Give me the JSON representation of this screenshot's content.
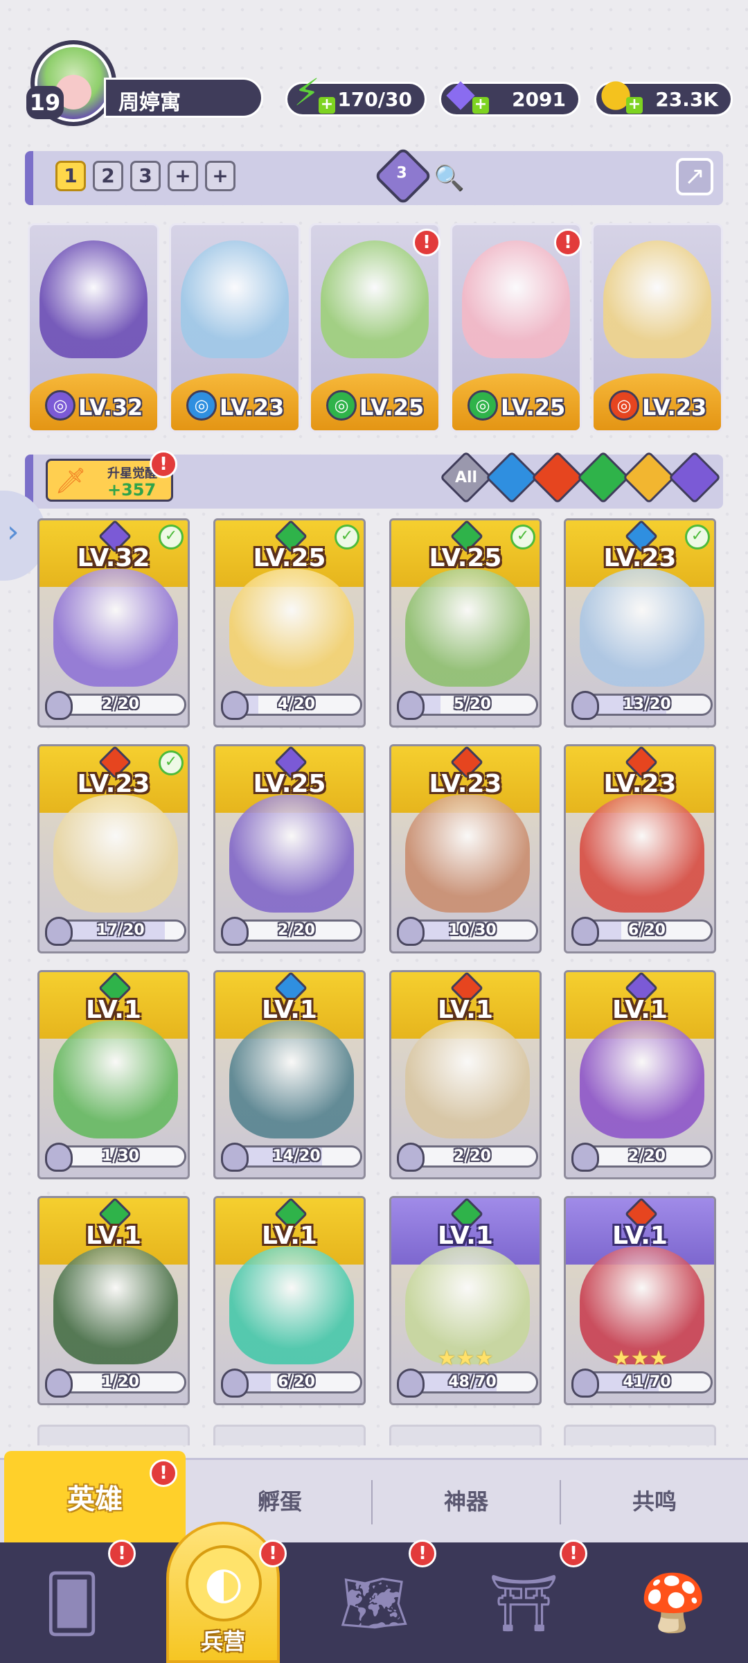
{
  "player": {
    "level": "19",
    "name": "周婷寓"
  },
  "resources": [
    {
      "icon": "energy-bolt-icon",
      "value": "170/30",
      "color": "#5fd13a"
    },
    {
      "icon": "purple-gem-icon",
      "value": "2091",
      "color": "#8a6cf0"
    },
    {
      "icon": "gold-coin-icon",
      "value": "23.3K",
      "color": "#f4c21e"
    }
  ],
  "team_bar": {
    "slots": [
      "1",
      "2",
      "3",
      "+",
      "+"
    ],
    "active_slot": "1",
    "gem_count": "3"
  },
  "team": [
    {
      "element": "dark",
      "element_color": "#7b5ad6",
      "level": "LV.32",
      "art_color": "#6d4fb6",
      "alert": false
    },
    {
      "element": "water",
      "element_color": "#2f8fe0",
      "level": "LV.23",
      "art_color": "#9fc9e8",
      "alert": false
    },
    {
      "element": "wind",
      "element_color": "#2fb34a",
      "level": "LV.25",
      "art_color": "#9ed07a",
      "alert": true
    },
    {
      "element": "wind",
      "element_color": "#2fb34a",
      "level": "LV.25",
      "art_color": "#f4b8c6",
      "alert": true
    },
    {
      "element": "fire",
      "element_color": "#e6451f",
      "level": "LV.23",
      "art_color": "#efd48a",
      "alert": false
    }
  ],
  "awaken": {
    "label": "升星觉醒",
    "count": "+357"
  },
  "filters": [
    {
      "name": "all",
      "label": "All",
      "color": "#9a98ad"
    },
    {
      "name": "water",
      "label": "",
      "color": "#2f8fe0"
    },
    {
      "name": "fire",
      "label": "",
      "color": "#e6451f"
    },
    {
      "name": "wind",
      "label": "",
      "color": "#2fb34a"
    },
    {
      "name": "light",
      "label": "",
      "color": "#f2b630"
    },
    {
      "name": "dark",
      "label": "",
      "color": "#7b5ad6"
    }
  ],
  "heroes": [
    {
      "level": "LV.32",
      "element_color": "#7b5ad6",
      "progress": "2/20",
      "ratio": 0.1,
      "checked": true,
      "art_color": "#8c6fd6",
      "frame": "gold",
      "stars": ""
    },
    {
      "level": "LV.25",
      "element_color": "#2fb34a",
      "progress": "4/20",
      "ratio": 0.2,
      "checked": true,
      "art_color": "#f6d36a",
      "frame": "gold",
      "stars": ""
    },
    {
      "level": "LV.25",
      "element_color": "#2fb34a",
      "progress": "5/20",
      "ratio": 0.25,
      "checked": true,
      "art_color": "#8bbf6a",
      "frame": "gold",
      "stars": ""
    },
    {
      "level": "LV.23",
      "element_color": "#2f8fe0",
      "progress": "13/20",
      "ratio": 0.65,
      "checked": true,
      "art_color": "#a9c6e6",
      "frame": "gold",
      "stars": ""
    },
    {
      "level": "LV.23",
      "element_color": "#e6451f",
      "progress": "17/20",
      "ratio": 0.85,
      "checked": true,
      "art_color": "#ead7a0",
      "frame": "gold",
      "stars": ""
    },
    {
      "level": "LV.25",
      "element_color": "#7b5ad6",
      "progress": "2/20",
      "ratio": 0.1,
      "checked": false,
      "art_color": "#7d62c8",
      "frame": "gold",
      "stars": ""
    },
    {
      "level": "LV.23",
      "element_color": "#e6451f",
      "progress": "10/30",
      "ratio": 0.33,
      "checked": false,
      "art_color": "#c98a6a",
      "frame": "gold",
      "stars": ""
    },
    {
      "level": "LV.23",
      "element_color": "#e6451f",
      "progress": "6/20",
      "ratio": 0.3,
      "checked": false,
      "art_color": "#d8453a",
      "frame": "gold",
      "stars": ""
    },
    {
      "level": "LV.1",
      "element_color": "#2fb34a",
      "progress": "1/30",
      "ratio": 0.03,
      "checked": false,
      "art_color": "#5fb85a",
      "frame": "gold",
      "stars": ""
    },
    {
      "level": "LV.1",
      "element_color": "#2f8fe0",
      "progress": "14/20",
      "ratio": 0.7,
      "checked": false,
      "art_color": "#4f7f8c",
      "frame": "gold",
      "stars": ""
    },
    {
      "level": "LV.1",
      "element_color": "#e6451f",
      "progress": "2/20",
      "ratio": 0.1,
      "checked": false,
      "art_color": "#d9c6a0",
      "frame": "gold",
      "stars": ""
    },
    {
      "level": "LV.1",
      "element_color": "#7b5ad6",
      "progress": "2/20",
      "ratio": 0.1,
      "checked": false,
      "art_color": "#8a4fc8",
      "frame": "gold",
      "stars": ""
    },
    {
      "level": "LV.1",
      "element_color": "#2fb34a",
      "progress": "1/20",
      "ratio": 0.05,
      "checked": false,
      "art_color": "#3f6a3f",
      "frame": "gold",
      "stars": ""
    },
    {
      "level": "LV.1",
      "element_color": "#2fb34a",
      "progress": "6/20",
      "ratio": 0.3,
      "checked": false,
      "art_color": "#3fc8a8",
      "frame": "gold",
      "stars": ""
    },
    {
      "level": "LV.1",
      "element_color": "#2fb34a",
      "progress": "48/70",
      "ratio": 0.69,
      "checked": false,
      "art_color": "#c6d89a",
      "frame": "purple",
      "stars": "★★★"
    },
    {
      "level": "LV.1",
      "element_color": "#e6451f",
      "progress": "41/70",
      "ratio": 0.59,
      "checked": false,
      "art_color": "#c8384a",
      "frame": "purple",
      "stars": "★★★"
    }
  ],
  "sub_tabs": [
    {
      "label": "英雄",
      "active": true,
      "alert": true
    },
    {
      "label": "孵蛋",
      "active": false,
      "alert": false
    },
    {
      "label": "神器",
      "active": false,
      "alert": false
    },
    {
      "label": "共鸣",
      "active": false,
      "alert": false
    }
  ],
  "bottom_nav": [
    {
      "icon": "cards-icon",
      "label": "",
      "alert": true
    },
    {
      "icon": "barracks-icon",
      "label": "兵营",
      "alert": true,
      "selected": true
    },
    {
      "icon": "map-book-icon",
      "label": "",
      "alert": true
    },
    {
      "icon": "temple-icon",
      "label": "",
      "alert": true
    },
    {
      "icon": "mushroom-icon",
      "label": "",
      "alert": false
    }
  ]
}
